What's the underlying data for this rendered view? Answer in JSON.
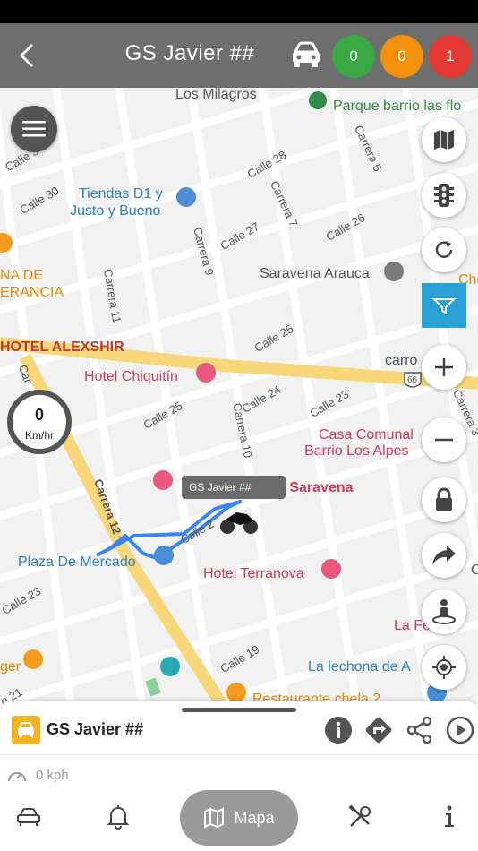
{
  "header": {
    "title": "GS Javier ##",
    "counts": [
      {
        "value": "0",
        "color": "#3aa843"
      },
      {
        "value": "0",
        "color": "#f4900c"
      },
      {
        "value": "1",
        "color": "#e53935"
      }
    ]
  },
  "map": {
    "labels": {
      "los_milagros": "Los Milagros",
      "parque": "Parque barrio las flo",
      "calle_30": "Calle 30",
      "calle_28": "Calle 28",
      "carrera_5": "Carrera 5",
      "calle_3": "Calle 3",
      "tiendas": "Tiendas D1 y",
      "tiendas2": "Justo y Bueno",
      "carrera_7": "Carrera 7",
      "carrera_9": "Carrera 9",
      "calle_27": "Calle 27",
      "calle_26": "Calle 26",
      "saravena_arauca": "Saravena Arauca",
      "na_de": "NA DE",
      "erancia": "ERANCIA",
      "carrera_11": "Carrera 11",
      "cho": "Cho",
      "hotel_alexshir": "HOTEL ALEXSHIR",
      "calle_25": "Calle 25",
      "carro": "carro",
      "route_66": "66",
      "hotel_chiquitin": "Hotel Chiquitín",
      "calle_24": "Calle 24",
      "calle_23": "Calle 23",
      "calle_25b": "Calle 25",
      "carrera_10": "Carrera 10",
      "car_left": "Car",
      "carrera_3": "Carrera 3",
      "casa_comunal": "Casa Comunal",
      "barrio_alpes": "Barrio Los Alpes",
      "e_saravena": "e Saravena",
      "carrera_12": "Carrera 12",
      "calle_2": "Calle 2",
      "plaza": "Plaza De Mercado",
      "hotel_terranova": "Hotel Terranova",
      "calle_23b": "Calle 23",
      "la_fe": "La Fe",
      "ger": "ger",
      "calle_19": "Calle 19",
      "la_lechona": "La lechona de A",
      "restaurante": "Restaurante chela 2",
      "calle_21": "e 21",
      "c_right": "C"
    },
    "speedometer": {
      "value": "0",
      "unit": "Km/hr"
    },
    "vehicle_tooltip": "GS Javier ##"
  },
  "sheet": {
    "vehicle_name": "GS Javier ##",
    "speed_text": "0 kph"
  },
  "nav": {
    "active_label": "Mapa"
  },
  "colors": {
    "header_bg": "#6e6e6e",
    "route": "#3b82f6",
    "accent": "#2aa2d6",
    "vehicle_icon_bg": "#f5b31f"
  }
}
